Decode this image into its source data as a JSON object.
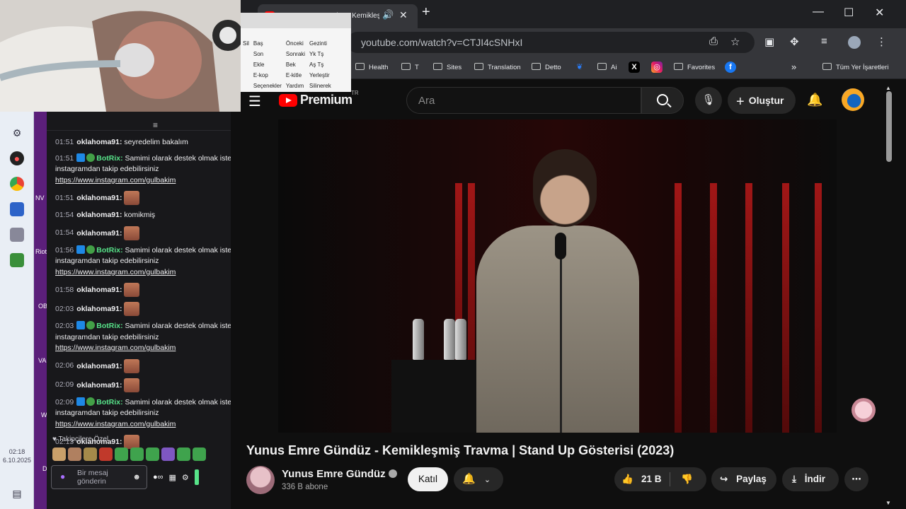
{
  "browser": {
    "tab_title": "Yunus Emre Gündüz - Kemikleşmiş Tr",
    "url": "youtube.com/watch?v=CTJI4cSNHxI",
    "bookmarks": [
      "Health",
      "T",
      "Sites",
      "Translation",
      "Detto",
      "Ai",
      "Favorites"
    ],
    "all_bookmarks": "Tüm Yer İşaretleri",
    "overflow": "»"
  },
  "popup": {
    "rows": [
      [
        "Sil",
        "Baş",
        "Önceki",
        "Gezinti"
      ],
      [
        "",
        "Son",
        "Sonraki",
        "Yk Tş"
      ],
      [
        "",
        "Ekle",
        "Bek",
        "Aş Tş"
      ],
      [
        "",
        "E-kop",
        "E-kitle",
        "Yerleştir"
      ],
      [
        "",
        "Seçenekler",
        "Yardım",
        "Silinerek"
      ]
    ]
  },
  "youtube": {
    "logo_text": "Premium",
    "country": "TR",
    "search_placeholder": "Ara",
    "create_label": "Oluştur",
    "video_title": "Yunus Emre Gündüz - Kemikleşmiş Travma | Stand Up Gösterisi (2023)",
    "channel_name": "Yunus Emre Gündüz",
    "subscribers": "336 B abone",
    "join_label": "Katıl",
    "likes": "21 B",
    "share_label": "Paylaş",
    "download_label": "İndir"
  },
  "chat": {
    "messages": [
      {
        "time": "01:51",
        "user": "oklahoma91:",
        "text": "seyredelim bakalım"
      },
      {
        "time": "01:51",
        "bot": "BotRix:",
        "text": "Samimi olarak destek olmak ister",
        "text2": "instagramdan takip edebilirsiniz",
        "link": "https://www.instagram.com/gulbakim"
      },
      {
        "time": "01:51",
        "user": "oklahoma91:",
        "emote": true
      },
      {
        "time": "01:54",
        "user": "oklahoma91:",
        "text": "komikmiş"
      },
      {
        "time": "01:54",
        "user": "oklahoma91:",
        "emote": true
      },
      {
        "time": "01:56",
        "bot": "BotRix:",
        "text": "Samimi olarak destek olmak ister",
        "text2": "instagramdan takip edebilirsiniz",
        "link": "https://www.instagram.com/gulbakim"
      },
      {
        "time": "01:58",
        "user": "oklahoma91:",
        "emote": true
      },
      {
        "time": "02:03",
        "user": "oklahoma91:",
        "emote": true
      },
      {
        "time": "02:03",
        "bot": "BotRix:",
        "text": "Samimi olarak destek olmak iste",
        "text2": "instagramdan takip edebilirsiniz",
        "link": "https://www.instagram.com/gulbakim"
      },
      {
        "time": "02:06",
        "user": "oklahoma91:",
        "emote": true
      },
      {
        "time": "02:09",
        "user": "oklahoma91:",
        "emote": true
      },
      {
        "time": "02:09",
        "bot": "BotRix:",
        "text": "Samimi olarak destek olmak iste",
        "text2": "instagramdan takip edebilirsiniz",
        "link": "https://www.instagram.com/gulbakim"
      },
      {
        "time": "02:13",
        "user": "oklahoma91:",
        "emote": true
      }
    ],
    "followers_only": "Takipçilere Özel",
    "input_placeholder_1": "Bir mesaj",
    "input_placeholder_2": "gönderin"
  },
  "desktop": {
    "labels": [
      "NV",
      "Riot",
      "OB",
      "VA",
      "W",
      "D"
    ],
    "clock_time": "02:18",
    "clock_date": "6.10.2025"
  },
  "colors": {
    "yt_red": "#ff0000",
    "bot_green": "#57e389",
    "twitch_purple": "#a970ff"
  }
}
